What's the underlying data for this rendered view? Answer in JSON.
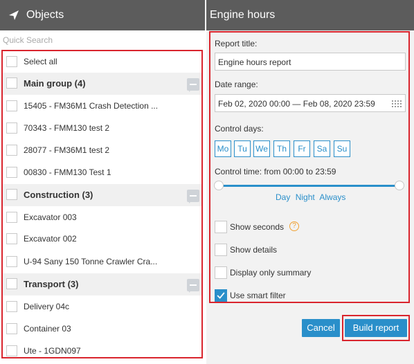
{
  "objects_panel": {
    "title": "Objects",
    "quick_search_placeholder": "Quick Search",
    "select_all_label": "Select all",
    "groups": [
      {
        "name": "Main group (4)",
        "items": [
          "15405 - FM36M1 Crash Detection ...",
          "70343 - FMM130 test 2",
          "28077 - FM36M1 test 2",
          "00830 - FMM130 Test 1"
        ]
      },
      {
        "name": "Construction (3)",
        "items": [
          "Excavator 003",
          "Excavator 002",
          "U-94 Sany 150 Tonne Crawler Cra..."
        ]
      },
      {
        "name": "Transport (3)",
        "items": [
          "Delivery 04c",
          "Container 03",
          "Ute - 1GDN097"
        ]
      }
    ]
  },
  "report_panel": {
    "title": "Engine hours",
    "report_title_label": "Report title:",
    "report_title_value": "Engine hours report",
    "date_range_label": "Date range:",
    "date_range_value": "Feb 02, 2020 00:00 — Feb 08, 2020 23:59",
    "control_days_label": "Control days:",
    "days": [
      "Mo",
      "Tu",
      "We",
      "Th",
      "Fr",
      "Sa",
      "Su"
    ],
    "control_time_label": "Control time: from 00:00 to 23:59",
    "time_links": [
      "Day",
      "Night",
      "Always"
    ],
    "options": [
      {
        "label": "Show seconds",
        "checked": false
      },
      {
        "label": "Show details",
        "checked": false
      },
      {
        "label": "Display only summary",
        "checked": false
      },
      {
        "label": "Use smart filter",
        "checked": true
      }
    ],
    "cancel_label": "Cancel",
    "build_label": "Build report"
  },
  "colors": {
    "header_bg": "#5c5c5c",
    "accent_blue": "#2a8fca",
    "highlight_red": "#d9242d",
    "help_orange": "#f0a030"
  }
}
